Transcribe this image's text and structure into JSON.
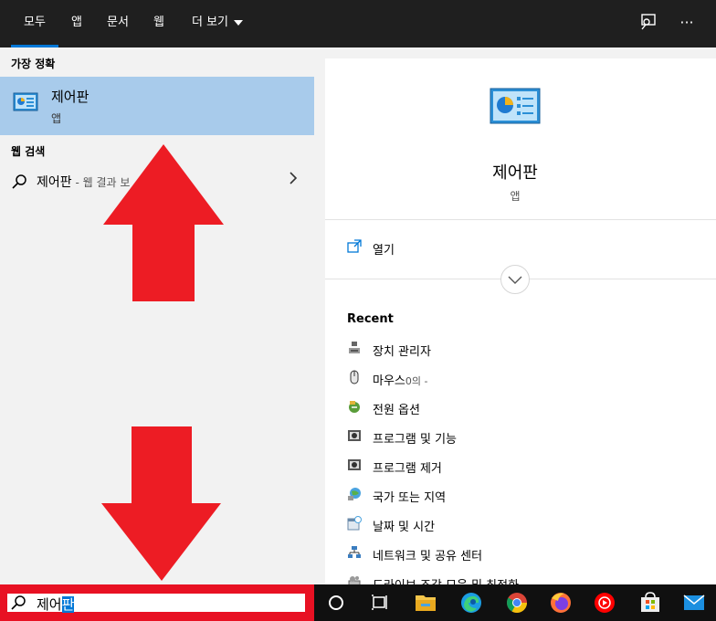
{
  "tabs": [
    {
      "label": "모두"
    },
    {
      "label": "앱"
    },
    {
      "label": "문서"
    },
    {
      "label": "웹"
    },
    {
      "label": "더 보기"
    }
  ],
  "top_icons": [
    "feedback-icon",
    "more-icon"
  ],
  "left": {
    "best_match_label": "가장 정확",
    "best": {
      "title": "제어판",
      "subtitle": "앱"
    },
    "web_label": "웹 검색",
    "web": {
      "query": "제어판",
      "suffix": " - 웹 결과 보"
    }
  },
  "right": {
    "app_title": "제어판",
    "app_subtitle": "앱",
    "open_label": "열기",
    "recent_heading": "Recent",
    "recent": [
      {
        "label": "장치 관리자",
        "icon": "device-manager-icon"
      },
      {
        "label": "마우스",
        "suffix": "0의 -",
        "icon": "mouse-icon"
      },
      {
        "label": "전원 옵션",
        "icon": "power-options-icon"
      },
      {
        "label": "프로그램 및 기능",
        "icon": "programs-features-icon"
      },
      {
        "label": "프로그램 제거",
        "icon": "uninstall-program-icon"
      },
      {
        "label": "국가 또는 지역",
        "icon": "region-icon"
      },
      {
        "label": "날짜 및 시간",
        "icon": "date-time-icon"
      },
      {
        "label": "네트워크 및 공유 센터",
        "icon": "network-center-icon"
      },
      {
        "label": "드라이브 조각 모음 및 최적화",
        "icon": "defrag-icon"
      }
    ]
  },
  "search": {
    "typed": "제어",
    "selected": "판"
  },
  "taskbar": [
    "cortana-icon",
    "task-view-icon",
    "file-explorer-icon",
    "edge-icon",
    "chrome-icon",
    "firefox-icon",
    "youtube-music-icon",
    "store-icon",
    "mail-icon"
  ],
  "colors": {
    "accent": "#0078d7",
    "selection": "#a8cbeb",
    "highlight": "#e81123"
  }
}
